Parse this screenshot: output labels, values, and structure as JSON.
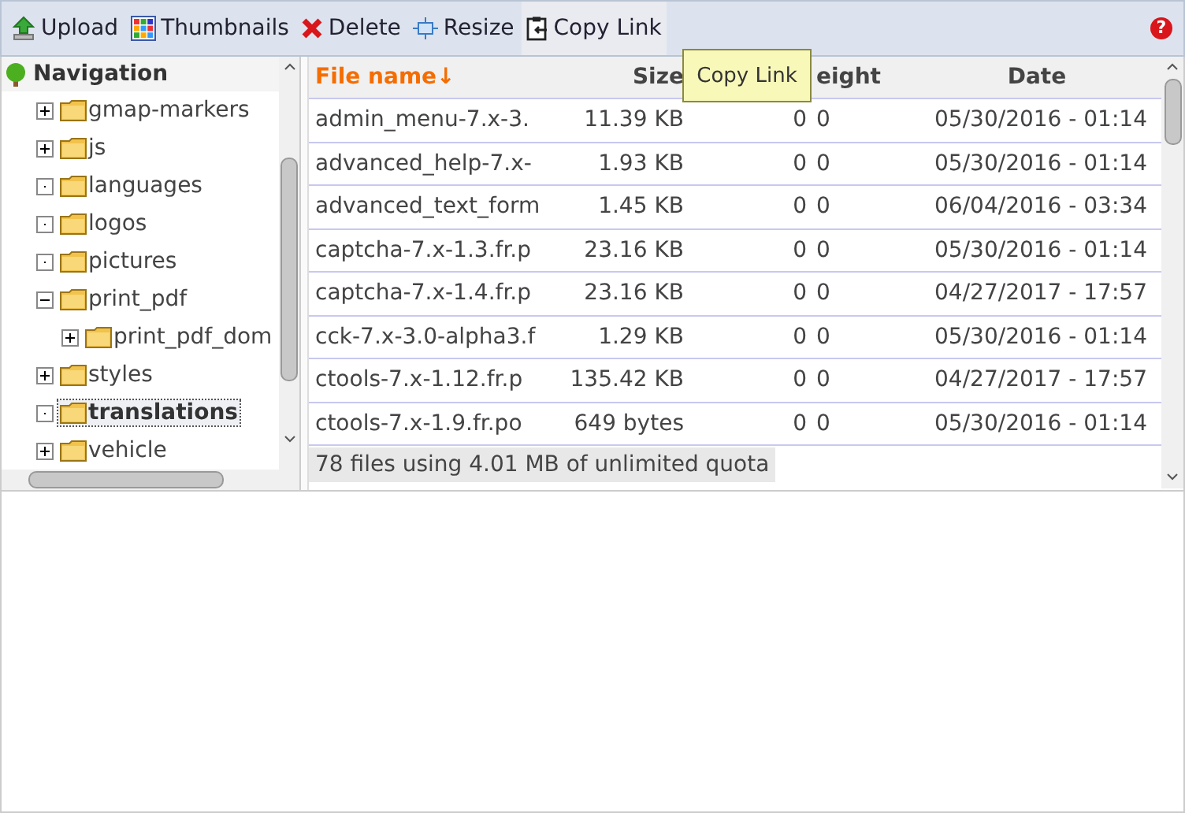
{
  "toolbar": {
    "buttons": [
      {
        "kind": "upload",
        "label": "Upload",
        "selected": false
      },
      {
        "kind": "thumbnails",
        "label": "Thumbnails",
        "selected": false
      },
      {
        "kind": "delete",
        "label": "Delete",
        "selected": false
      },
      {
        "kind": "resize",
        "label": "Resize",
        "selected": false
      },
      {
        "kind": "copy",
        "label": "Copy Link",
        "selected": true
      }
    ],
    "help": "?"
  },
  "tooltip": "Copy Link",
  "navigation": {
    "title": "Navigation",
    "items": [
      {
        "label": "gmap-markers",
        "kind": "plus",
        "selected": false
      },
      {
        "label": "js",
        "kind": "plus",
        "selected": false
      },
      {
        "label": "languages",
        "kind": "none",
        "selected": false
      },
      {
        "label": "logos",
        "kind": "none",
        "selected": false
      },
      {
        "label": "pictures",
        "kind": "none",
        "selected": false
      },
      {
        "label": "print_pdf",
        "kind": "minus",
        "selected": false,
        "children": [
          {
            "label": "print_pdf_dom",
            "kind": "plus",
            "selected": false
          }
        ]
      },
      {
        "label": "styles",
        "kind": "plus",
        "selected": false
      },
      {
        "label": "translations",
        "kind": "none",
        "selected": true
      },
      {
        "label": "vehicle",
        "kind": "plus",
        "selected": false
      }
    ]
  },
  "table": {
    "columns": [
      {
        "label": "File name↓",
        "sorted": true
      },
      {
        "label": "Size",
        "sorted": false
      },
      null,
      {
        "label": "eight",
        "sorted": false
      },
      {
        "label": "Date",
        "sorted": false
      }
    ],
    "rows": [
      [
        "admin_menu-7.x-3.",
        "11.39 KB",
        "0",
        "0",
        "05/30/2016 - 01:14"
      ],
      [
        "advanced_help-7.x-",
        "1.93 KB",
        "0",
        "0",
        "05/30/2016 - 01:14"
      ],
      [
        "advanced_text_form",
        "1.45 KB",
        "0",
        "0",
        "06/04/2016 - 03:34"
      ],
      [
        "captcha-7.x-1.3.fr.p",
        "23.16 KB",
        "0",
        "0",
        "05/30/2016 - 01:14"
      ],
      [
        "captcha-7.x-1.4.fr.p",
        "23.16 KB",
        "0",
        "0",
        "04/27/2017 - 17:57"
      ],
      [
        "cck-7.x-3.0-alpha3.f",
        "1.29 KB",
        "0",
        "0",
        "05/30/2016 - 01:14"
      ],
      [
        "ctools-7.x-1.12.fr.p",
        "135.42 KB",
        "0",
        "0",
        "04/27/2017 - 17:57"
      ],
      [
        "ctools-7.x-1.9.fr.po",
        "649 bytes",
        "0",
        "0",
        "05/30/2016 - 01:14"
      ]
    ]
  },
  "status_bar": "78 files using 4.01 MB of unlimited quota"
}
